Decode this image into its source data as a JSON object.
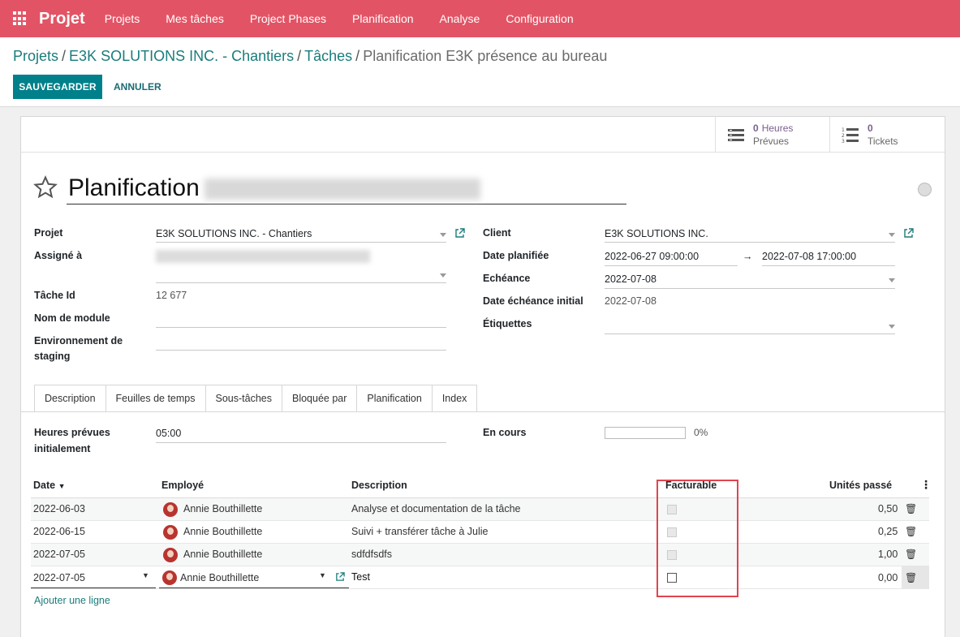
{
  "nav": {
    "app_title": "Projet",
    "items": [
      "Projets",
      "Mes tâches",
      "Project Phases",
      "Planification",
      "Analyse",
      "Configuration"
    ]
  },
  "breadcrumb": {
    "items": [
      "Projets",
      "E3K SOLUTIONS INC. - Chantiers",
      "Tâches"
    ],
    "current": "Planification E3K présence au bureau"
  },
  "actions": {
    "save": "SAUVEGARDER",
    "cancel": "ANNULER"
  },
  "stats": {
    "hours": {
      "value": "0",
      "label1": "Heures",
      "label2": "Prévues"
    },
    "tickets": {
      "value": "0",
      "label": "Tickets"
    }
  },
  "task": {
    "title": "Planification",
    "left": {
      "projet_label": "Projet",
      "projet_value": "E3K SOLUTIONS INC. - Chantiers",
      "assigne_label": "Assigné à",
      "tache_id_label": "Tâche Id",
      "tache_id_value": "12 677",
      "module_label": "Nom de module",
      "staging_label_1": "Environnement de",
      "staging_label_2": "staging"
    },
    "right": {
      "client_label": "Client",
      "client_value": "E3K SOLUTIONS INC.",
      "date_label": "Date planifiée",
      "date_start": "2022-06-27 09:00:00",
      "date_arrow": "→",
      "date_end": "2022-07-08 17:00:00",
      "echeance_label": "Echéance",
      "echeance_value": "2022-07-08",
      "echeance_initial_label": "Date échéance initial",
      "echeance_initial_value": "2022-07-08",
      "etiquettes_label": "Étiquettes"
    }
  },
  "tabs": [
    "Description",
    "Feuilles de temps",
    "Sous-tâches",
    "Bloquée par",
    "Planification",
    "Index"
  ],
  "active_tab": "Feuilles de temps",
  "timesheet": {
    "heures_label_1": "Heures prévues",
    "heures_label_2": "initialement",
    "heures_value": "05:00",
    "en_cours_label": "En cours",
    "progress_percent": 0,
    "progress_text": "0%",
    "columns": {
      "date": "Date",
      "employe": "Employé",
      "description": "Description",
      "facturable": "Facturable",
      "unites": "Unités passé"
    },
    "rows": [
      {
        "date": "2022-06-03",
        "employee": "Annie Bouthillette",
        "description": "Analyse et documentation de la tâche",
        "facturable": false,
        "units": "0,50"
      },
      {
        "date": "2022-06-15",
        "employee": "Annie Bouthillette",
        "description": "Suivi + transférer tâche à Julie",
        "facturable": false,
        "units": "0,25"
      },
      {
        "date": "2022-07-05",
        "employee": "Annie Bouthillette",
        "description": "sdfdfsdfs",
        "facturable": false,
        "units": "1,00"
      }
    ],
    "edit_row": {
      "date": "2022-07-05",
      "employee": "Annie Bouthillette",
      "description": "Test",
      "facturable": false,
      "units": "0,00"
    },
    "add_line": "Ajouter une ligne"
  },
  "colors": {
    "nav": "#e25465",
    "primary": "#00808a",
    "link": "#1b7c7c",
    "highlight": "#e0454f"
  }
}
